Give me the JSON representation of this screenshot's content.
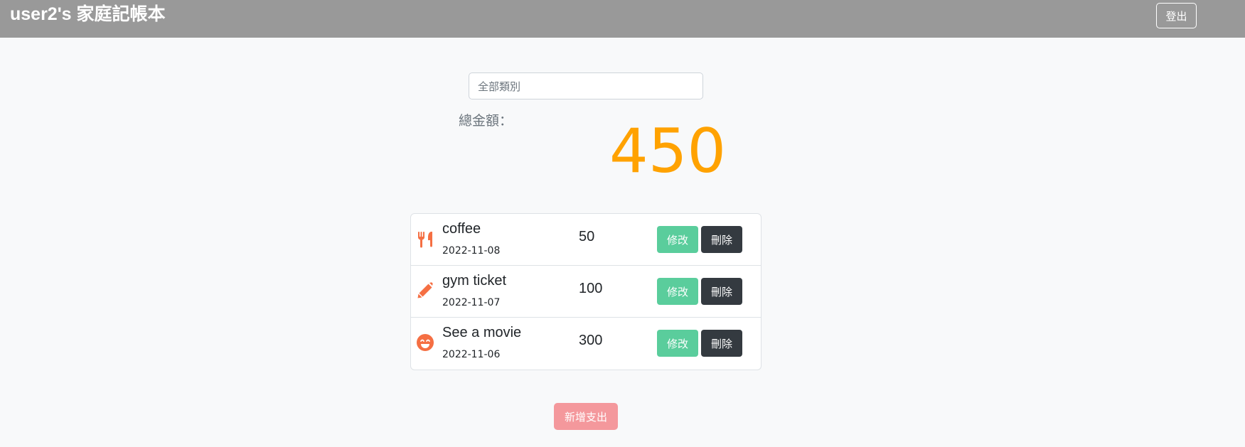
{
  "header": {
    "title": "user2's 家庭記帳本",
    "logout_label": "登出"
  },
  "filter": {
    "category_selected": "全部類別"
  },
  "summary": {
    "total_label": "總金額：",
    "total_value": "450"
  },
  "records": [
    {
      "icon": "utensils-icon",
      "name": "coffee",
      "date": "2022-11-08",
      "amount": "50",
      "edit_label": "修改",
      "delete_label": "刪除"
    },
    {
      "icon": "pencil-icon",
      "name": "gym ticket",
      "date": "2022-11-07",
      "amount": "100",
      "edit_label": "修改",
      "delete_label": "刪除"
    },
    {
      "icon": "smile-icon",
      "name": "See a movie",
      "date": "2022-11-06",
      "amount": "300",
      "edit_label": "修改",
      "delete_label": "刪除"
    }
  ],
  "actions": {
    "add_label": "新增支出"
  },
  "colors": {
    "navbar": "#999999",
    "accent_amount": "#ffa200",
    "icon": "#f56f43",
    "edit_button": "#5acd9c",
    "delete_button": "#343a40",
    "add_button": "#f4989c"
  }
}
